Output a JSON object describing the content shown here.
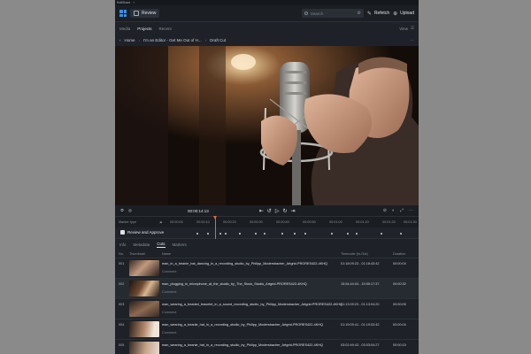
{
  "window": {
    "title": "EditShare",
    "close": "×"
  },
  "toolbar": {
    "review_label": "Review",
    "search_placeholder": "Search",
    "refetch_label": "Refetch",
    "upload_label": "Upload"
  },
  "nav": {
    "tabs": [
      {
        "label": "Media"
      },
      {
        "label": "Projects"
      },
      {
        "label": "Recent"
      }
    ],
    "view_label": "View"
  },
  "breadcrumb": {
    "home": "Home",
    "project": "I'm an Editor - Get Me Out of H...",
    "cut": "Draft Cut"
  },
  "player": {
    "timecode": "00:00:14:13"
  },
  "timeline": {
    "marker_type_label": "Marker type",
    "ruler_ticks": [
      "00:00:00",
      "00:00:10",
      "00:00:20",
      "00:00:30",
      "00:00:40",
      "00:00:50",
      "00:01:00",
      "00:01:10",
      "00:01:20",
      "00:01:30",
      "00:01:40"
    ],
    "track_label": "Review and Approve"
  },
  "subtabs": [
    "Info",
    "Metadata",
    "Cuts",
    "Markers"
  ],
  "table": {
    "headers": {
      "no": "No.",
      "thumbnail": "Thumbnail",
      "name": "Name",
      "timecode": "Timecode (In-Out)",
      "duration": "Duration"
    },
    "rows": [
      {
        "no": "001",
        "name": "man_in_a_beanie_hat_dancing_in_a_recording_studio_by_Philipp_Modersbacher_Artgrid-PRORES422-4KHQ",
        "comment": "Comment",
        "timecode": "01:18:09:23 - 01:18:43:42",
        "duration": "00:00:04"
      },
      {
        "no": "002",
        "name": "man_plugging_in_microphone_at_the_studio_by_The_Stock_Studio_Artgrid-PRORES422-4KHQ",
        "comment": "Comment",
        "timecode": "15:54:44:04 - 15:55:17:37",
        "duration": "00:00:32"
      },
      {
        "no": "003",
        "name": "man_wearing_a_beaded_bracelet_in_a_sound_recording_studio_by_Philipp_Modersbacher_Artgrid-PRORES422-4KHQ",
        "comment": "Comment",
        "timecode": "01:13:09:23 - 01:13:04:20",
        "duration": "00:00:05"
      },
      {
        "no": "004",
        "name": "man_wearing_a_beanie_hat_in_a_recording_studio_by_Philipp_Modersbacher_Artgrid-PRORES422-4KHQ",
        "comment": "Comment",
        "timecode": "01:19:09:41 - 01:19:03:42",
        "duration": "00:00:04"
      },
      {
        "no": "005",
        "name": "man_wearing_a_beanie_hat_in_a_recording_studio_by_Philipp_Modersbacher_Artgrid-PRORES422-4KHQ",
        "comment": "",
        "timecode": "03:02:49:43 - 03:03:04:27",
        "duration": "00:00:15"
      }
    ]
  }
}
